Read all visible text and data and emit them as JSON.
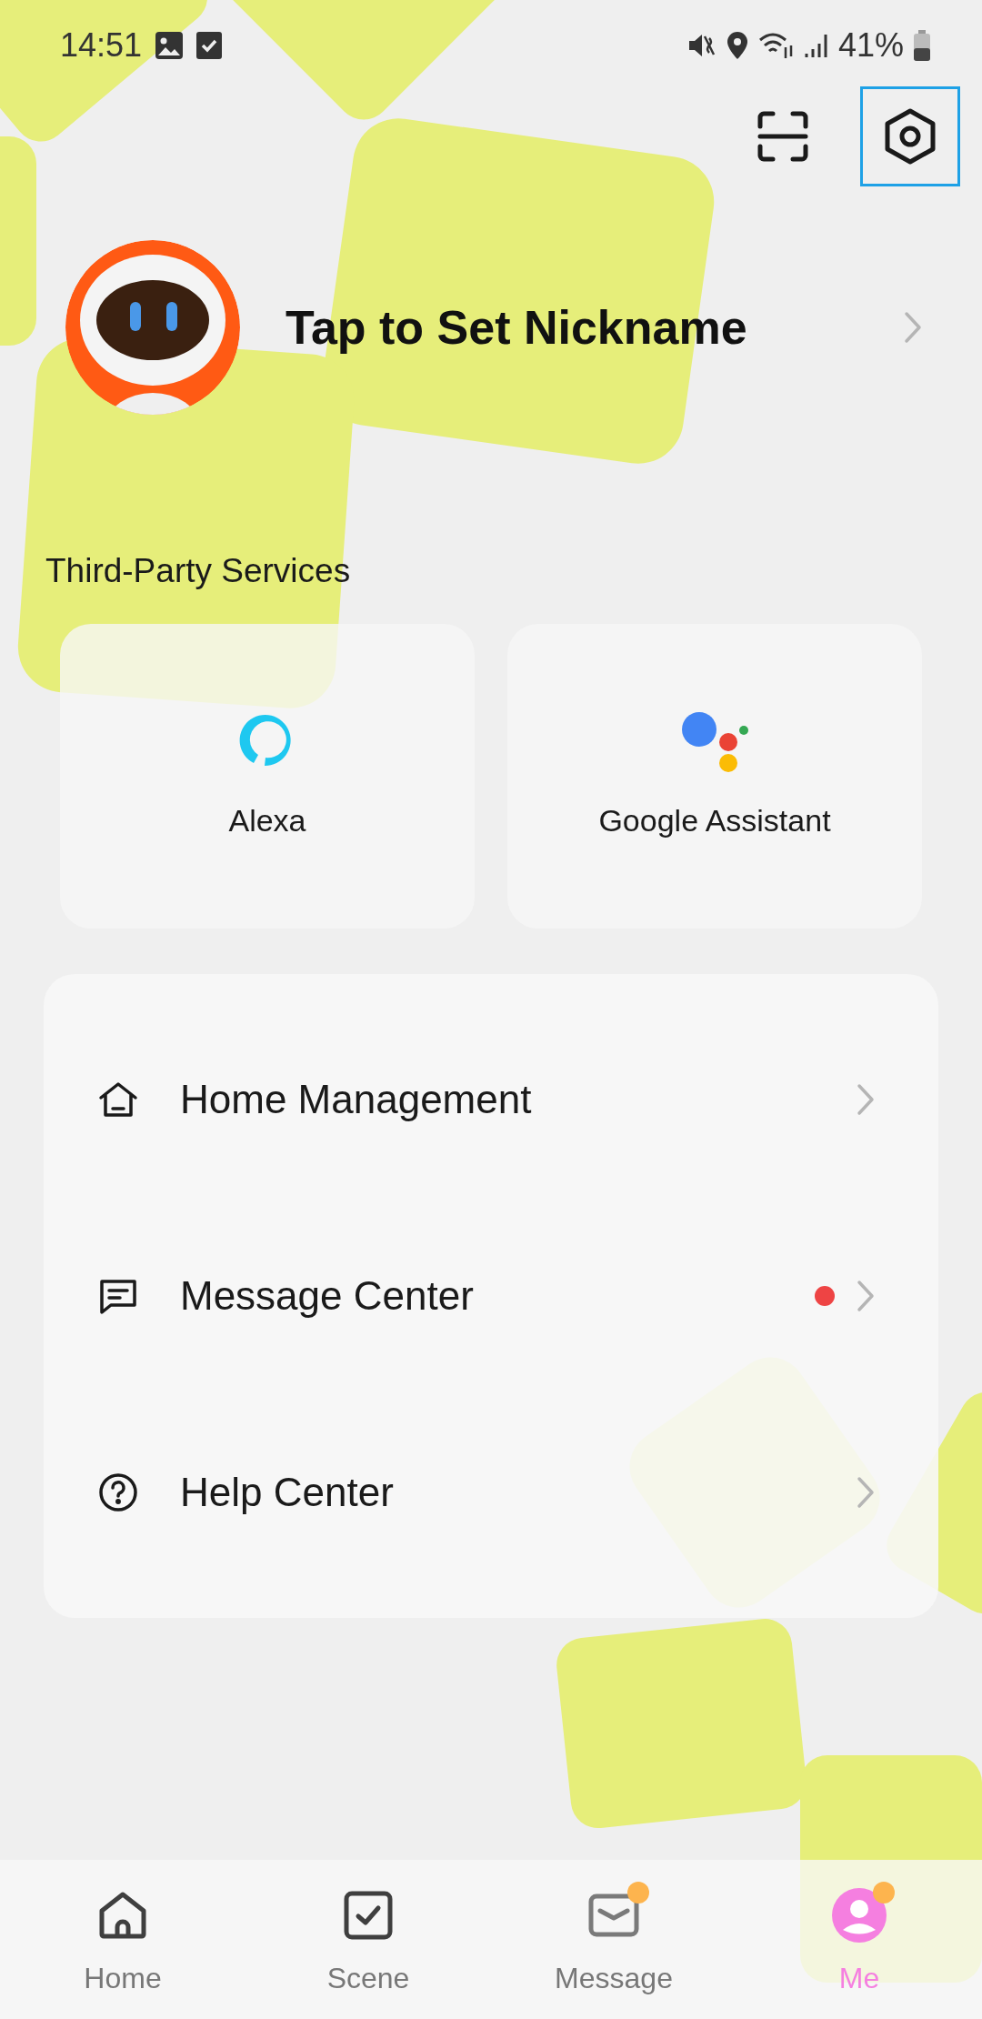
{
  "status_bar": {
    "time": "14:51",
    "battery": "41%"
  },
  "header": {
    "buttons": [
      {
        "kind": "scan",
        "focused": false
      },
      {
        "kind": "settings",
        "focused": true
      }
    ]
  },
  "profile": {
    "nickname": "Tap to Set Nickname"
  },
  "third_party": {
    "title": "Third-Party Services",
    "services": [
      {
        "kind": "alexa",
        "label": "Alexa"
      },
      {
        "kind": "google",
        "label": "Google Assistant"
      }
    ]
  },
  "menu": [
    {
      "kind": "home",
      "label": "Home Management",
      "unread": false
    },
    {
      "kind": "message",
      "label": "Message Center",
      "unread": true
    },
    {
      "kind": "help",
      "label": "Help Center",
      "unread": false
    }
  ],
  "tabs": [
    {
      "kind": "home",
      "label": "Home",
      "selected": false,
      "badge": false
    },
    {
      "kind": "scene",
      "label": "Scene",
      "selected": false,
      "badge": false
    },
    {
      "kind": "message",
      "label": "Message",
      "selected": false,
      "badge": true
    },
    {
      "kind": "me",
      "label": "Me",
      "selected": true,
      "badge": true
    }
  ]
}
